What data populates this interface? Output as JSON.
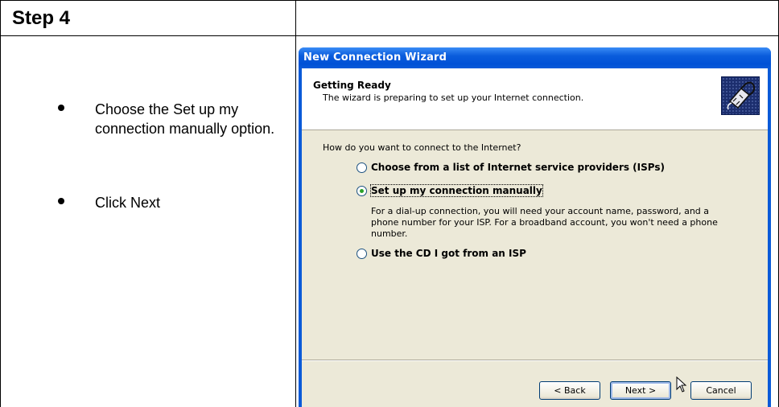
{
  "step_title": "Step 4",
  "instructions": [
    "Choose the Set up my connection manually option.",
    "Click Next"
  ],
  "wizard": {
    "title": "New Connection Wizard",
    "header_title": "Getting Ready",
    "header_subtitle": "The wizard is preparing to set up your Internet connection.",
    "question": "How do you want to connect to the Internet?",
    "options": [
      {
        "label": "Choose from a list of Internet service providers (ISPs)",
        "selected": false
      },
      {
        "label": "Set up my connection manually",
        "selected": true
      },
      {
        "label": "Use the CD I got from an ISP",
        "selected": false
      }
    ],
    "manual_description": "For a dial-up connection, you will need your account name, password, and a phone number for your ISP. For a broadband account, you won't need a phone number.",
    "buttons": {
      "back": "< Back",
      "next": "Next >",
      "cancel": "Cancel"
    },
    "icon": "internet-connection-icon",
    "colors": {
      "titlebar": "#0a5ad8",
      "client": "#ece9d8",
      "radio_checked": "#2aa12a"
    }
  }
}
